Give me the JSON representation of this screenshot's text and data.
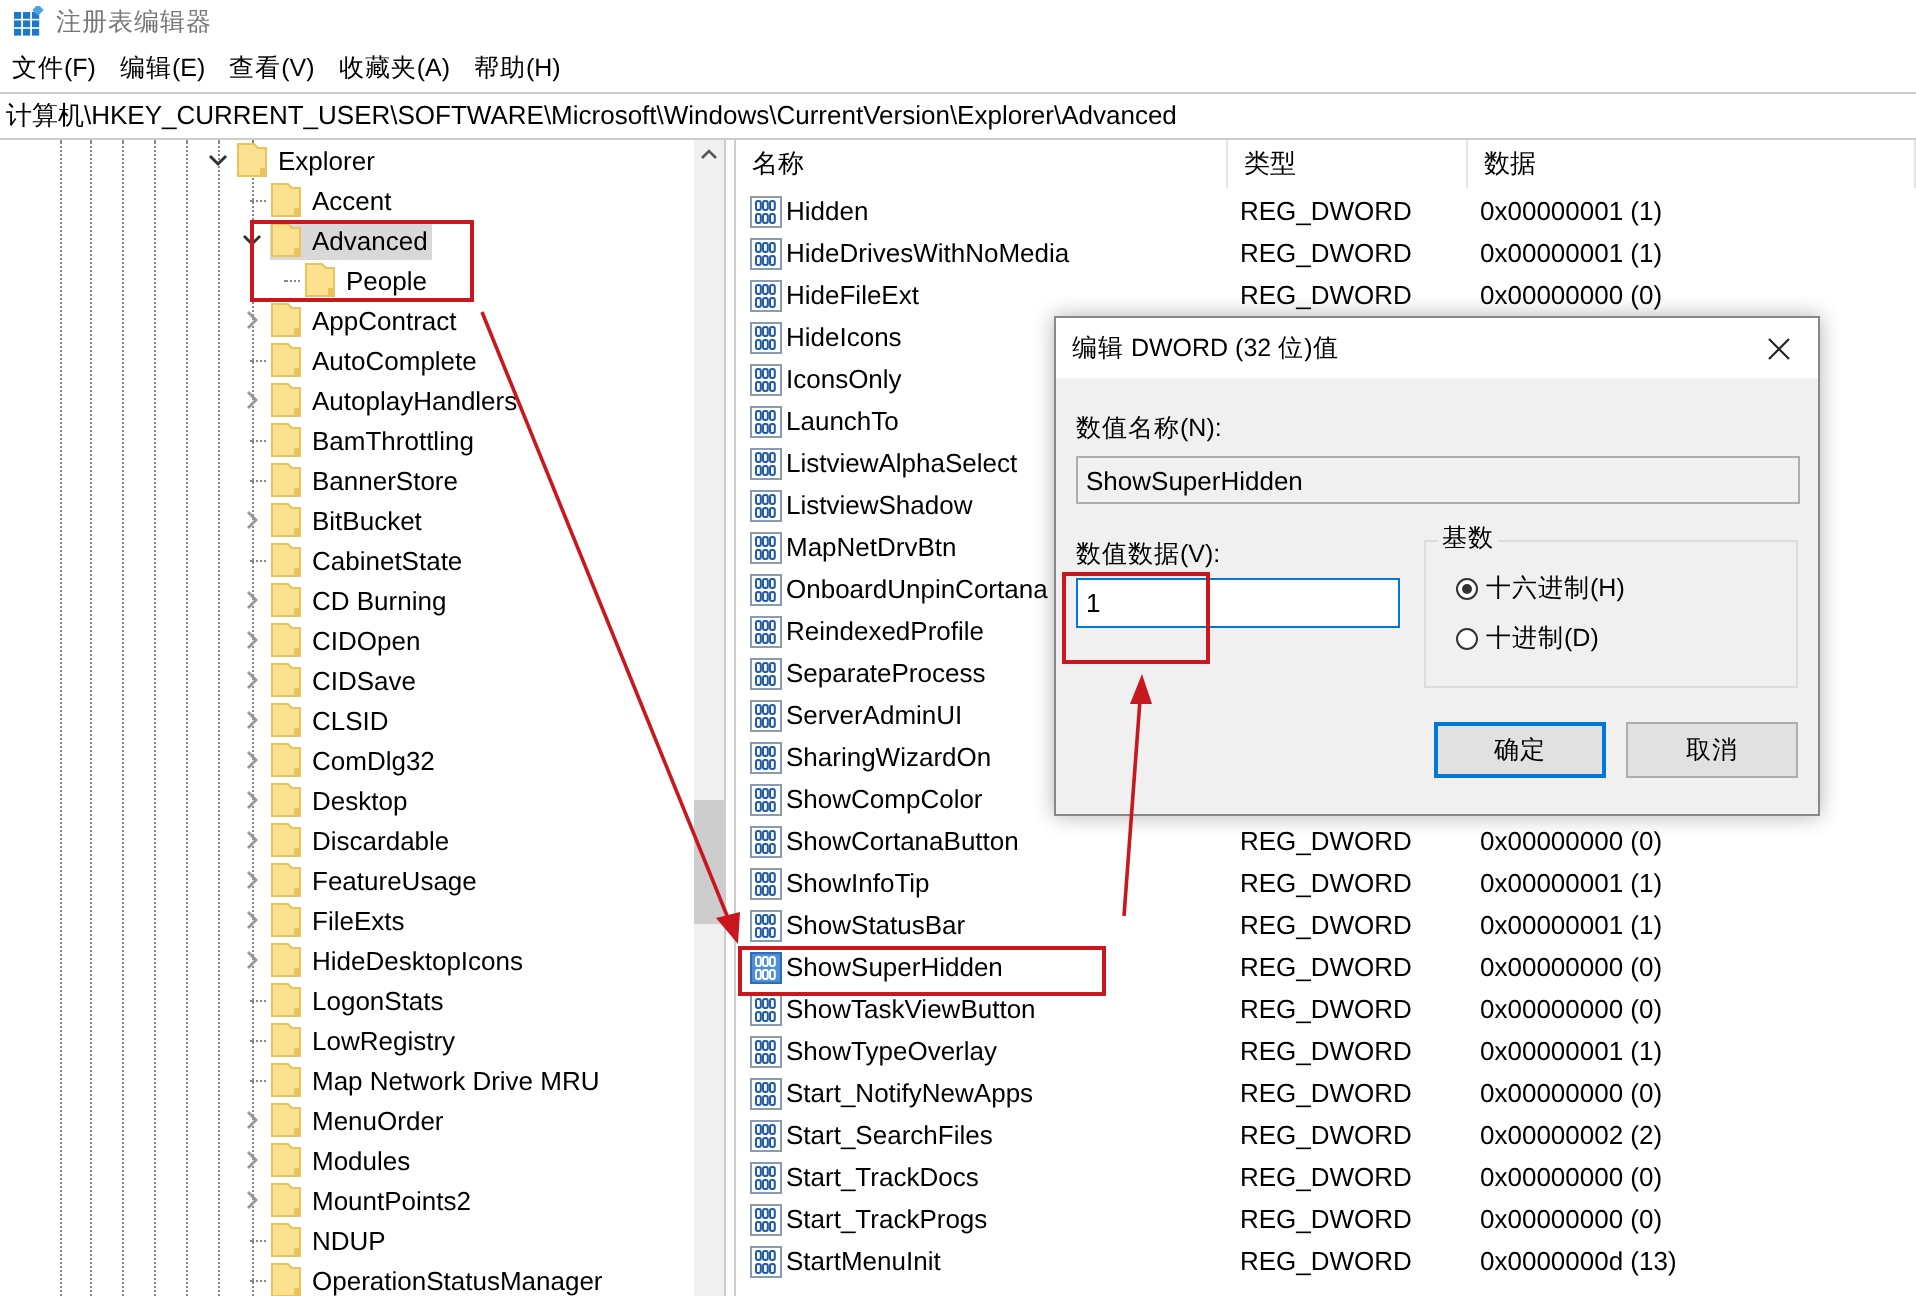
{
  "window": {
    "title": "注册表编辑器"
  },
  "menu": [
    "文件(F)",
    "编辑(E)",
    "查看(V)",
    "收藏夹(A)",
    "帮助(H)"
  ],
  "address": "计算机\\HKEY_CURRENT_USER\\SOFTWARE\\Microsoft\\Windows\\CurrentVersion\\Explorer\\Advanced",
  "tree": [
    {
      "label": "Explorer",
      "expanded": true,
      "selected": false,
      "children": [
        {
          "label": "Accent",
          "selected": false
        },
        {
          "label": "Advanced",
          "expanded": true,
          "selected": true,
          "children": [
            {
              "label": "People",
              "selected": false
            }
          ]
        },
        {
          "label": "AppContract",
          "expanded": false,
          "selected": false
        },
        {
          "label": "AutoComplete",
          "selected": false
        },
        {
          "label": "AutoplayHandlers",
          "expanded": false,
          "selected": false
        },
        {
          "label": "BamThrottling",
          "selected": false
        },
        {
          "label": "BannerStore",
          "selected": false
        },
        {
          "label": "BitBucket",
          "expanded": false,
          "selected": false
        },
        {
          "label": "CabinetState",
          "selected": false
        },
        {
          "label": "CD Burning",
          "expanded": false,
          "selected": false
        },
        {
          "label": "CIDOpen",
          "expanded": false,
          "selected": false
        },
        {
          "label": "CIDSave",
          "expanded": false,
          "selected": false
        },
        {
          "label": "CLSID",
          "expanded": false,
          "selected": false
        },
        {
          "label": "ComDlg32",
          "expanded": false,
          "selected": false
        },
        {
          "label": "Desktop",
          "expanded": false,
          "selected": false
        },
        {
          "label": "Discardable",
          "expanded": false,
          "selected": false
        },
        {
          "label": "FeatureUsage",
          "expanded": false,
          "selected": false
        },
        {
          "label": "FileExts",
          "expanded": false,
          "selected": false
        },
        {
          "label": "HideDesktopIcons",
          "expanded": false,
          "selected": false
        },
        {
          "label": "LogonStats",
          "selected": false
        },
        {
          "label": "LowRegistry",
          "selected": false
        },
        {
          "label": "Map Network Drive MRU",
          "selected": false
        },
        {
          "label": "MenuOrder",
          "expanded": false,
          "selected": false
        },
        {
          "label": "Modules",
          "expanded": false,
          "selected": false
        },
        {
          "label": "MountPoints2",
          "expanded": false,
          "selected": false
        },
        {
          "label": "NDUP",
          "selected": false
        },
        {
          "label": "OperationStatusManager",
          "selected": false
        }
      ]
    }
  ],
  "table": {
    "columns": [
      "名称",
      "类型",
      "数据"
    ],
    "rows": [
      {
        "name": "Hidden",
        "type": "REG_DWORD",
        "data": "0x00000001 (1)",
        "selected": false
      },
      {
        "name": "HideDrivesWithNoMedia",
        "type": "REG_DWORD",
        "data": "0x00000001 (1)",
        "selected": false
      },
      {
        "name": "HideFileExt",
        "type": "REG_DWORD",
        "data": "0x00000000 (0)",
        "selected": false
      },
      {
        "name": "HideIcons",
        "selected": false
      },
      {
        "name": "IconsOnly",
        "selected": false
      },
      {
        "name": "LaunchTo",
        "selected": false
      },
      {
        "name": "ListviewAlphaSelect",
        "selected": false
      },
      {
        "name": "ListviewShadow",
        "selected": false
      },
      {
        "name": "MapNetDrvBtn",
        "selected": false
      },
      {
        "name": "OnboardUnpinCortana",
        "selected": false
      },
      {
        "name": "ReindexedProfile",
        "selected": false
      },
      {
        "name": "SeparateProcess",
        "selected": false
      },
      {
        "name": "ServerAdminUI",
        "selected": false
      },
      {
        "name": "SharingWizardOn",
        "selected": false
      },
      {
        "name": "ShowCompColor",
        "selected": false
      },
      {
        "name": "ShowCortanaButton",
        "type": "REG_DWORD",
        "data": "0x00000000 (0)",
        "selected": false
      },
      {
        "name": "ShowInfoTip",
        "type": "REG_DWORD",
        "data": "0x00000001 (1)",
        "selected": false
      },
      {
        "name": "ShowStatusBar",
        "type": "REG_DWORD",
        "data": "0x00000001 (1)",
        "selected": false
      },
      {
        "name": "ShowSuperHidden",
        "type": "REG_DWORD",
        "data": "0x00000000 (0)",
        "selected": true
      },
      {
        "name": "ShowTaskViewButton",
        "type": "REG_DWORD",
        "data": "0x00000000 (0)",
        "selected": false
      },
      {
        "name": "ShowTypeOverlay",
        "type": "REG_DWORD",
        "data": "0x00000001 (1)",
        "selected": false
      },
      {
        "name": "Start_NotifyNewApps",
        "type": "REG_DWORD",
        "data": "0x00000000 (0)",
        "selected": false
      },
      {
        "name": "Start_SearchFiles",
        "type": "REG_DWORD",
        "data": "0x00000002 (2)",
        "selected": false
      },
      {
        "name": "Start_TrackDocs",
        "type": "REG_DWORD",
        "data": "0x00000000 (0)",
        "selected": false
      },
      {
        "name": "Start_TrackProgs",
        "type": "REG_DWORD",
        "data": "0x00000000 (0)",
        "selected": false
      },
      {
        "name": "StartMenuInit",
        "type": "REG_DWORD",
        "data": "0x0000000d (13)",
        "selected": false
      }
    ]
  },
  "dialog": {
    "title": "编辑 DWORD (32 位)值",
    "name_label": "数值名称(N):",
    "name_value": "ShowSuperHidden",
    "data_label": "数值数据(V):",
    "data_value": "1",
    "base_label": "基数",
    "bases": [
      {
        "label": "十六进制(H)",
        "selected": true
      },
      {
        "label": "十进制(D)",
        "selected": false
      }
    ],
    "buttons": [
      {
        "label": "确定",
        "default": true
      },
      {
        "label": "取消",
        "default": false
      }
    ]
  }
}
